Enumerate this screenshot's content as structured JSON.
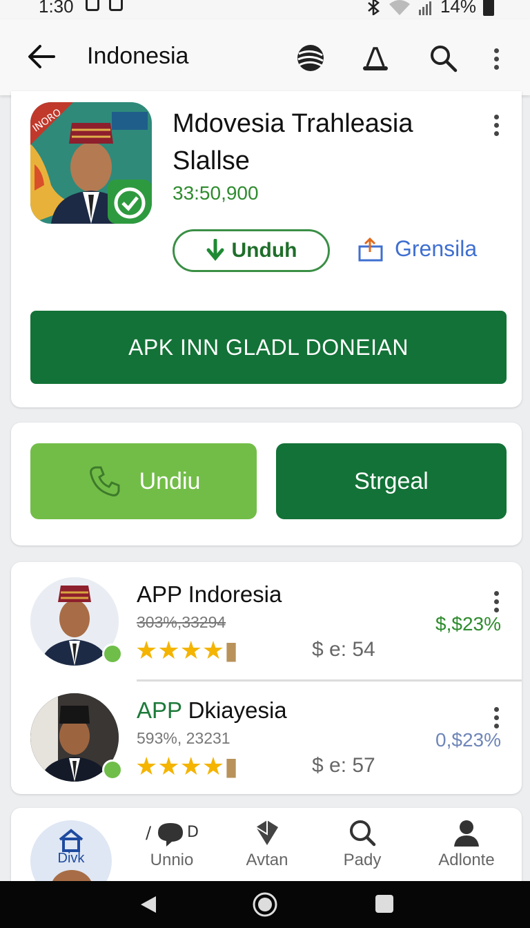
{
  "status_bar": {
    "time": "1:30",
    "battery": "14%"
  },
  "app_bar": {
    "title": "Indonesia"
  },
  "app": {
    "name": "Mdovesia Trahleasia Slallse",
    "count": "33:50,900",
    "download_label": "Unduh",
    "share_label": "Grensila",
    "apk_button": "APK INN GLADL DONEIAN",
    "icon_banner": "INORO"
  },
  "actions": {
    "primary": "Undiu",
    "secondary": "Strgeal"
  },
  "list": [
    {
      "name": "APP Indoresia",
      "sub": "303%,33294",
      "meta": "$ e: 54",
      "price": "$,$23%",
      "price_color": "#2e8b2e",
      "rating": 4
    },
    {
      "name_accent": "APP",
      "name_rest": " Dkiayesia",
      "sub": "593%, 23231",
      "meta": "$ e: 57",
      "price": "0,$23%",
      "price_color": "#6f86b8",
      "rating": 4
    }
  ],
  "bottom_nav": [
    {
      "label": "Divk",
      "icon": "home-icon"
    },
    {
      "label": "Unnio",
      "icon": "chat-icon"
    },
    {
      "label": "Avtan",
      "icon": "cube-icon"
    },
    {
      "label": "Pady",
      "icon": "search-icon"
    },
    {
      "label": "Adlonte",
      "icon": "person-icon"
    }
  ],
  "colors": {
    "primary": "#137237",
    "accent_light": "#72bd48",
    "link": "#3f6fd0"
  }
}
